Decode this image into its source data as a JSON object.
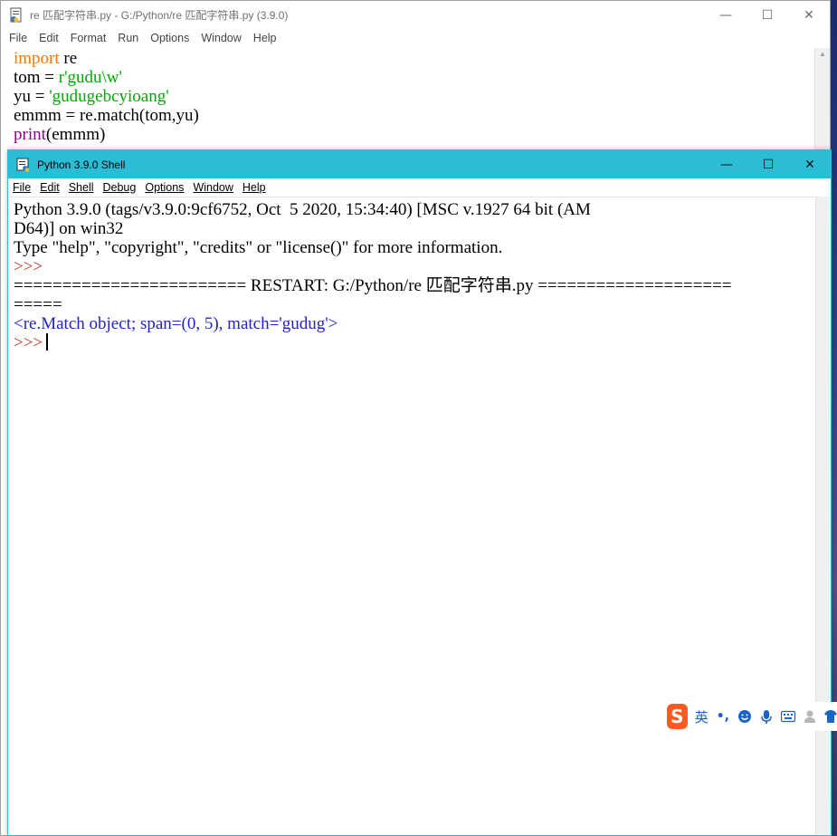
{
  "editor": {
    "title": "re 匹配字符串.py - G:/Python/re 匹配字符串.py (3.9.0)",
    "menu": [
      "File",
      "Edit",
      "Format",
      "Run",
      "Options",
      "Window",
      "Help"
    ],
    "code": {
      "l1_kw": "import",
      "l1_rest": " re",
      "l2_a": "tom = ",
      "l2_str": "r'gudu\\w'",
      "l3_a": "yu = ",
      "l3_str": "'gudugebcyioang'",
      "l4": "emmm = re.match(tom,yu)",
      "l5_bi": "print",
      "l5_rest": "(emmm)"
    }
  },
  "shell": {
    "title": "Python 3.9.0 Shell",
    "menu": [
      "File",
      "Edit",
      "Shell",
      "Debug",
      "Options",
      "Window",
      "Help"
    ],
    "lines": {
      "banner1": "Python 3.9.0 (tags/v3.9.0:9cf6752, Oct  5 2020, 15:34:40) [MSC v.1927 64 bit (AM",
      "banner2": "D64)] on win32",
      "banner3": "Type \"help\", \"copyright\", \"credits\" or \"license()\" for more information.",
      "prompt": ">>>",
      "restart1": "======================== RESTART: G:/Python/re 匹配字符串.py ====================",
      "restart2": "=====",
      "output": "<re.Match object; span=(0, 5), match='gudug'>",
      "prompt2": ">>>"
    }
  },
  "window_controls": {
    "minimize": "—",
    "maximize": "☐",
    "close": "✕"
  },
  "ime": {
    "logo": "S",
    "lang": "英",
    "punct": "•,",
    "icons": [
      "emoji-icon",
      "microphone-icon",
      "keyboard-icon",
      "user-icon",
      "shirt-icon"
    ]
  },
  "colors": {
    "shell_titlebar": "#2bbdd6",
    "keyword": "#ff7700",
    "string": "#00aa00",
    "builtin": "#900090",
    "prompt": "#c1392b",
    "output": "#2222cc"
  }
}
